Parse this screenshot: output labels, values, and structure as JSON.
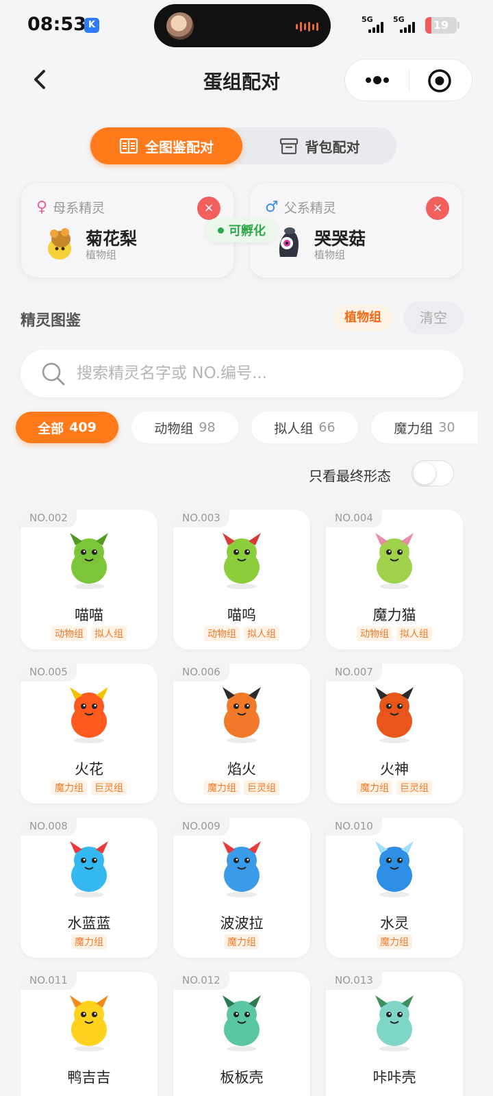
{
  "status_bar": {
    "time": "08:53",
    "app_badge": "K",
    "signal_1": "5G",
    "signal_2": "5G",
    "battery": "19",
    "battery_level": 0.19
  },
  "nav": {
    "title": "蛋组配对"
  },
  "mode_tabs": [
    {
      "label": "全图鉴配对",
      "active": true
    },
    {
      "label": "背包配对",
      "active": false
    }
  ],
  "mother": {
    "role_symbol": "♀",
    "role": "母系精灵",
    "name": "菊花梨",
    "group": "植物组",
    "close": "×"
  },
  "father": {
    "role_symbol": "♂",
    "role": "父系精灵",
    "name": "哭哭菇",
    "group": "植物组",
    "close": "×"
  },
  "hatch_status": "可孵化",
  "dex": {
    "title": "精灵图鉴",
    "active_filter": "植物组",
    "clear": "清空",
    "search_placeholder": "搜索精灵名字或 NO.编号..."
  },
  "group_tabs": [
    {
      "label": "全部",
      "count": "409",
      "active": true
    },
    {
      "label": "动物组",
      "count": "98",
      "active": false
    },
    {
      "label": "拟人组",
      "count": "66",
      "active": false
    },
    {
      "label": "魔力组",
      "count": "30",
      "active": false
    }
  ],
  "final_form_toggle": {
    "label": "只看最终形态",
    "on": false
  },
  "pokemon": [
    {
      "no": "NO.002",
      "name": "喵喵",
      "tags": [
        "动物组",
        "拟人组"
      ],
      "color": "#7cc43a",
      "accent": "#4e9a22"
    },
    {
      "no": "NO.003",
      "name": "喵呜",
      "tags": [
        "动物组",
        "拟人组"
      ],
      "color": "#8ccd3c",
      "accent": "#d93a3a"
    },
    {
      "no": "NO.004",
      "name": "魔力猫",
      "tags": [
        "动物组",
        "拟人组"
      ],
      "color": "#9fd14a",
      "accent": "#e98aa6"
    },
    {
      "no": "NO.005",
      "name": "火花",
      "tags": [
        "魔力组",
        "巨灵组"
      ],
      "color": "#ff5a1e",
      "accent": "#f2c100"
    },
    {
      "no": "NO.006",
      "name": "焰火",
      "tags": [
        "魔力组",
        "巨灵组"
      ],
      "color": "#f07a2a",
      "accent": "#2c2c2c"
    },
    {
      "no": "NO.007",
      "name": "火神",
      "tags": [
        "魔力组",
        "巨灵组"
      ],
      "color": "#e8561b",
      "accent": "#2b2b2b"
    },
    {
      "no": "NO.008",
      "name": "水蓝蓝",
      "tags": [
        "魔力组"
      ],
      "color": "#35b8f0",
      "accent": "#e83a3a"
    },
    {
      "no": "NO.009",
      "name": "波波拉",
      "tags": [
        "魔力组"
      ],
      "color": "#3a9ce8",
      "accent": "#e83a3a"
    },
    {
      "no": "NO.010",
      "name": "水灵",
      "tags": [
        "魔力组"
      ],
      "color": "#2f8ee6",
      "accent": "#9fe0ff"
    },
    {
      "no": "NO.011",
      "name": "鸭吉吉",
      "tags": [],
      "color": "#ffd21e",
      "accent": "#f08c1e"
    },
    {
      "no": "NO.012",
      "name": "板板壳",
      "tags": [],
      "color": "#5ac6a4",
      "accent": "#2c7a4e"
    },
    {
      "no": "NO.013",
      "name": "咔咔壳",
      "tags": [],
      "color": "#7fd6c6",
      "accent": "#3f8f5a"
    }
  ]
}
